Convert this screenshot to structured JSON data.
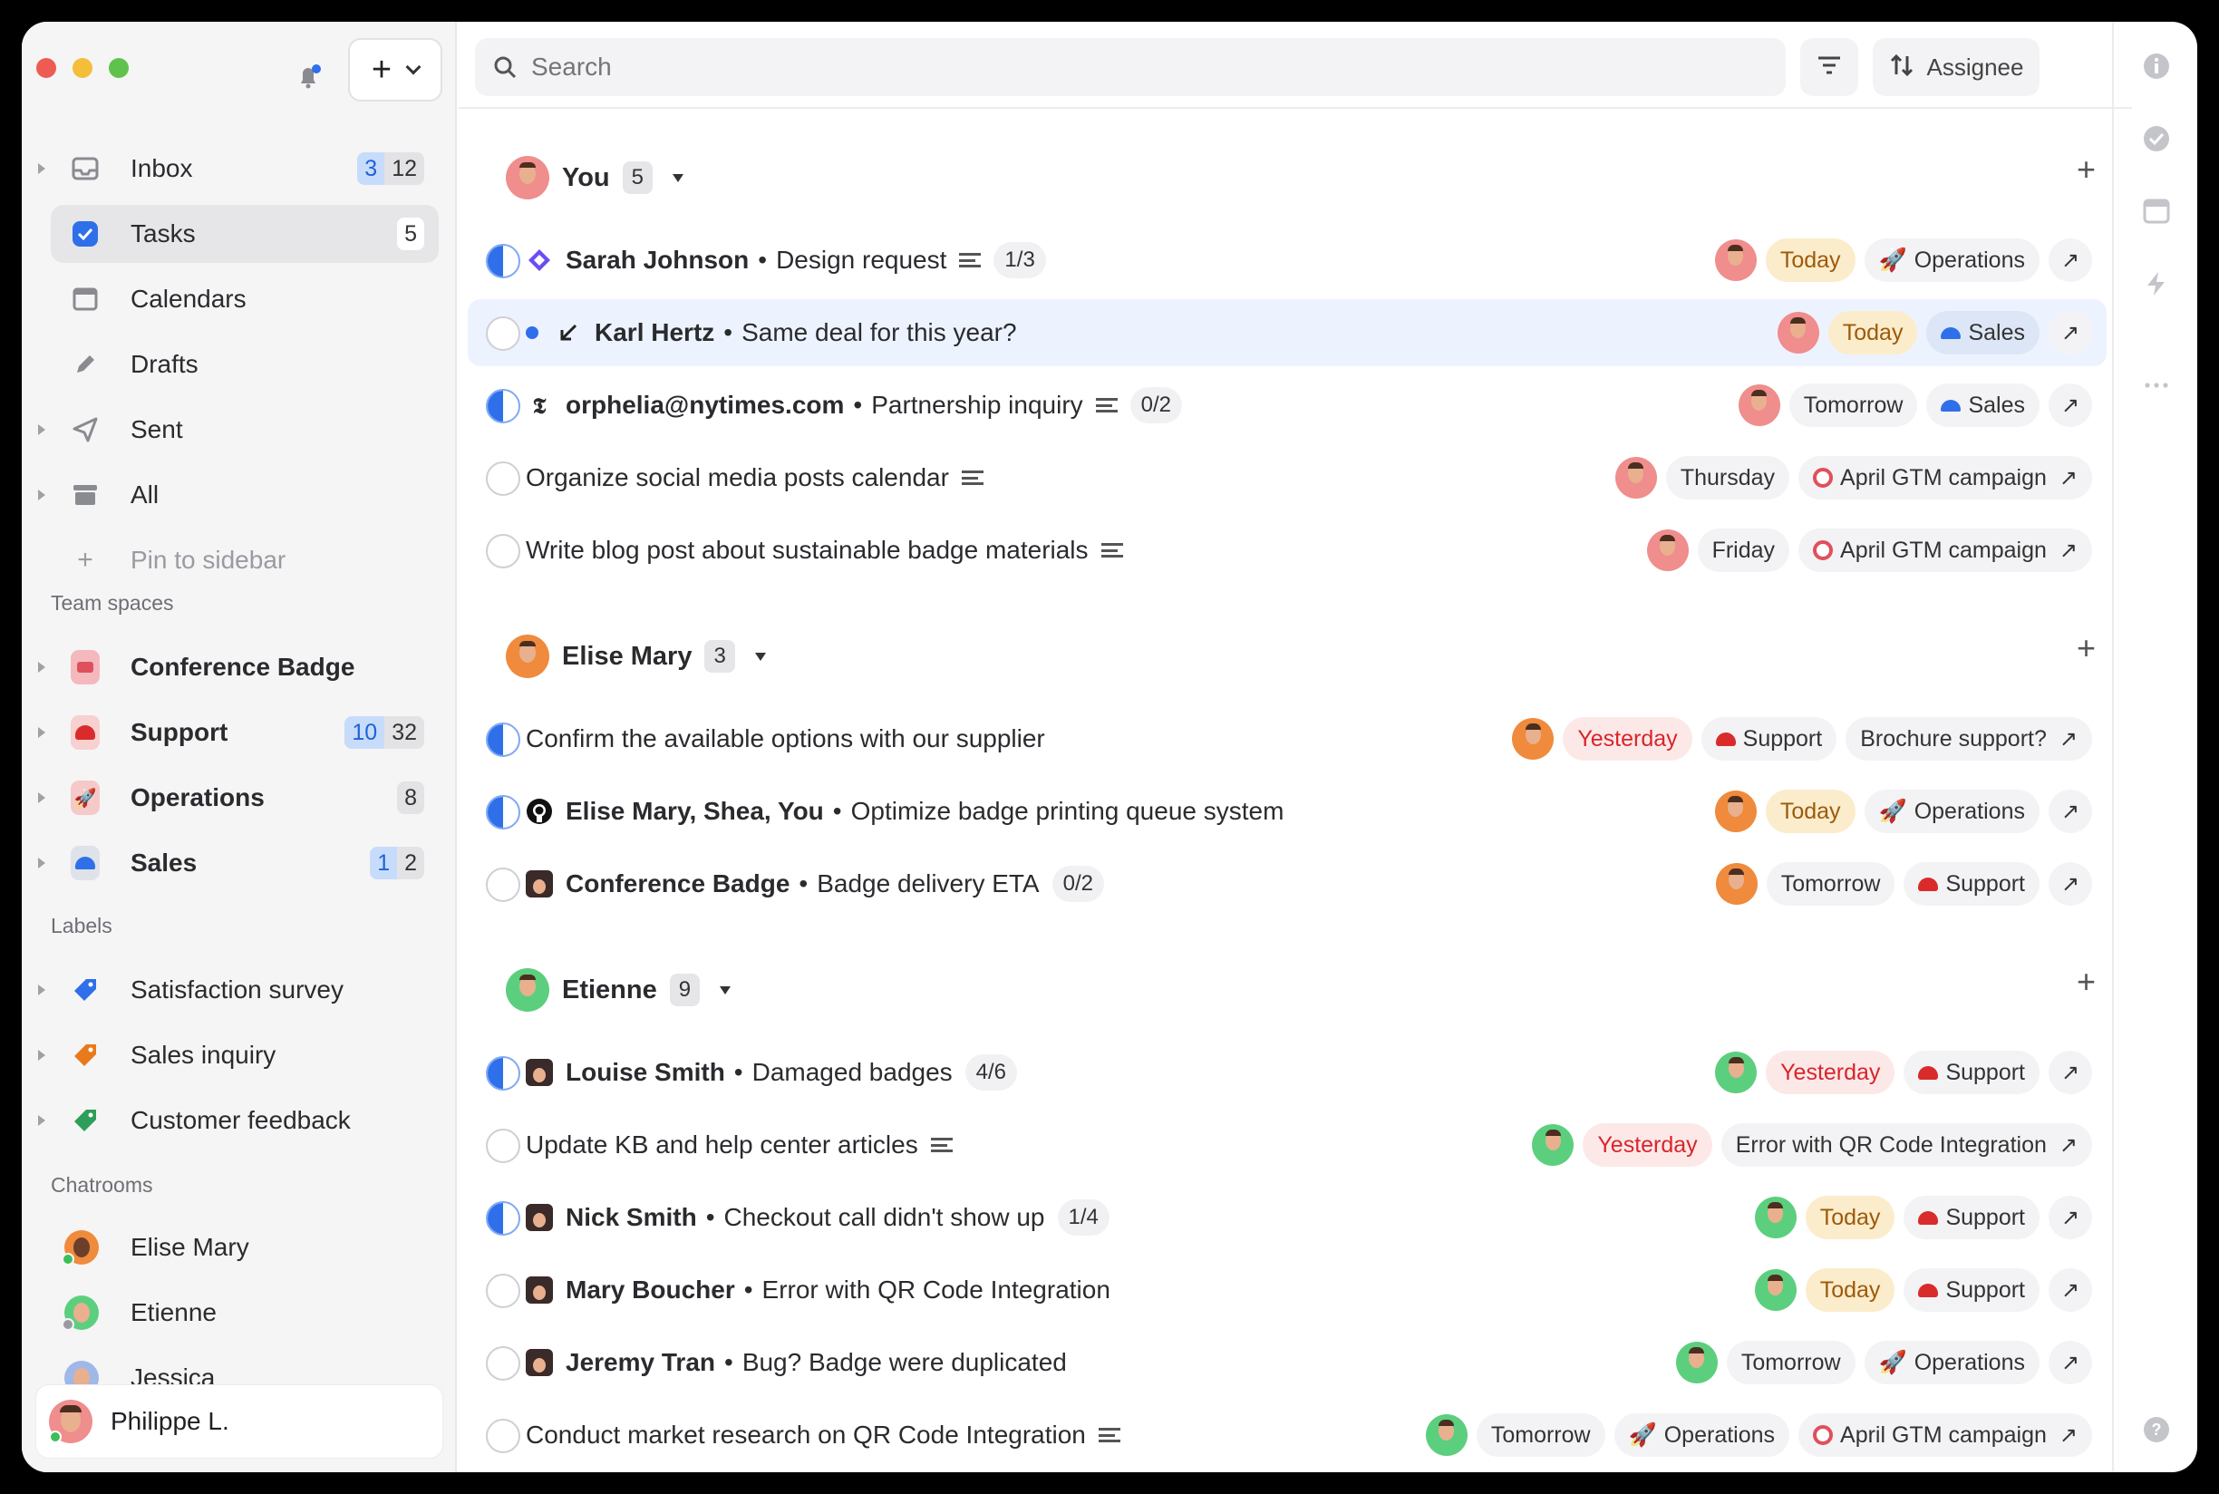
{
  "sidebar": {
    "nav": [
      {
        "label": "Inbox",
        "count_blue": "3",
        "count": "12"
      },
      {
        "label": "Tasks",
        "count": "5"
      },
      {
        "label": "Calendars"
      },
      {
        "label": "Drafts"
      },
      {
        "label": "Sent"
      },
      {
        "label": "All"
      },
      {
        "label": "Pin to sidebar"
      }
    ],
    "team_spaces_heading": "Team spaces",
    "spaces": [
      {
        "label": "Conference Badge"
      },
      {
        "label": "Support",
        "count_blue": "10",
        "count": "32"
      },
      {
        "label": "Operations",
        "count": "8"
      },
      {
        "label": "Sales",
        "count_blue": "1",
        "count": "2"
      }
    ],
    "labels_heading": "Labels",
    "labels": [
      {
        "label": "Satisfaction survey",
        "color": "#2f6fea"
      },
      {
        "label": "Sales inquiry",
        "color": "#e77b1c"
      },
      {
        "label": "Customer feedback",
        "color": "#2e9e5b"
      }
    ],
    "chatrooms_heading": "Chatrooms",
    "chatrooms": [
      {
        "label": "Elise Mary"
      },
      {
        "label": "Etienne"
      },
      {
        "label": "Jessica"
      }
    ],
    "user": {
      "name": "Philippe L."
    }
  },
  "toolbar": {
    "search_placeholder": "Search",
    "sort_label": "Assignee"
  },
  "groups": [
    {
      "name": "You",
      "count": "5",
      "tasks": [
        {
          "who": "Sarah Johnson",
          "sep": "•",
          "title": "Design request",
          "desc": true,
          "sub": "1/3",
          "half": true,
          "date": "Today",
          "project": "Operations",
          "src": "diamond"
        },
        {
          "who": "Karl Hertz",
          "sep": "•",
          "title": "Same deal for this year?",
          "unread": true,
          "date": "Today",
          "project": "Sales",
          "src": "reply"
        },
        {
          "who": "orphelia@nytimes.com",
          "sep": "•",
          "title": "Partnership inquiry",
          "desc": true,
          "sub": "0/2",
          "half": true,
          "date": "Tomorrow",
          "project": "Sales",
          "src": "nyt"
        },
        {
          "title": "Organize social media posts calendar",
          "desc": true,
          "date": "Thursday",
          "project": "April GTM campaign"
        },
        {
          "title": "Write blog post about sustainable badge materials",
          "desc": true,
          "date": "Friday",
          "project": "April GTM campaign"
        }
      ]
    },
    {
      "name": "Elise Mary",
      "count": "3",
      "tasks": [
        {
          "title": "Confirm the available options with our supplier",
          "half": true,
          "date": "Yesterday",
          "project": "Support",
          "project2": "Brochure support?"
        },
        {
          "who": "Elise Mary, Shea, You",
          "sep": "•",
          "title": "Optimize badge printing queue system",
          "half": true,
          "date": "Today",
          "project": "Operations",
          "src": "github"
        },
        {
          "who": "Conference Badge",
          "sep": "•",
          "title": "Badge delivery ETA",
          "sub": "0/2",
          "date": "Tomorrow",
          "project": "Support",
          "src": "person"
        }
      ]
    },
    {
      "name": "Etienne",
      "count": "9",
      "tasks": [
        {
          "who": "Louise Smith",
          "sep": "•",
          "title": "Damaged badges",
          "sub": "4/6",
          "half": true,
          "date": "Yesterday",
          "project": "Support",
          "src": "person"
        },
        {
          "title": "Update KB and help center articles",
          "desc": true,
          "date": "Yesterday",
          "project2": "Error with QR Code Integration"
        },
        {
          "who": "Nick Smith",
          "sep": "•",
          "title": "Checkout call didn't show up",
          "sub": "1/4",
          "half": true,
          "date": "Today",
          "project": "Support",
          "src": "person"
        },
        {
          "who": "Mary Boucher",
          "sep": "•",
          "title": "Error with QR Code Integration",
          "date": "Today",
          "project": "Support",
          "src": "person"
        },
        {
          "who": "Jeremy Tran",
          "sep": "•",
          "title": "Bug? Badge were duplicated",
          "date": "Tomorrow",
          "project": "Operations",
          "src": "person"
        },
        {
          "title": "Conduct market research on QR Code Integration",
          "desc": true,
          "date": "Tomorrow",
          "project": "Operations",
          "project2": "April GTM campaign"
        }
      ]
    }
  ],
  "colors": {
    "accent": "#2f6fea",
    "today_bg": "#fbeccb",
    "yesterday_text": "#d7262b"
  }
}
